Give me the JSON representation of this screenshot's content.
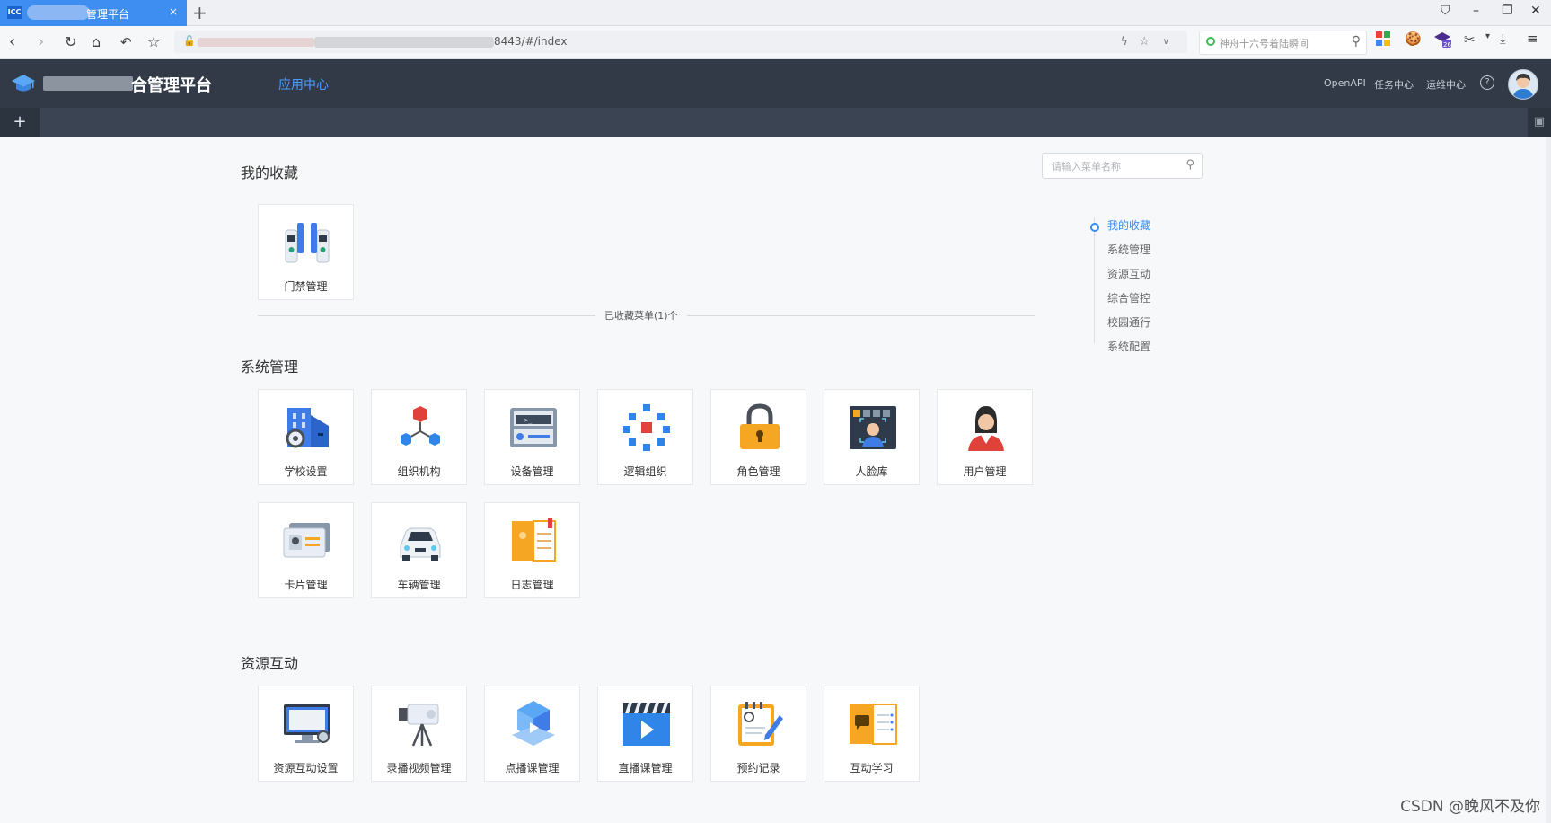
{
  "browser": {
    "tab": {
      "favicon": "ICC",
      "title": "管理平台",
      "close": "×"
    },
    "new_tab": "+",
    "window_controls": {
      "shirt": "⛉",
      "minimize": "–",
      "restore": "❐",
      "close": "✕"
    },
    "url_text": "8443/#/index",
    "search_placeholder": "神舟十六号着陆瞬间",
    "icons": [
      "back-icon",
      "forward-icon",
      "reload-icon",
      "home-icon",
      "undo-icon",
      "star-icon"
    ]
  },
  "app": {
    "brand": "合管理平台",
    "nav_active": "应用中心",
    "header_links": [
      "OpenAPI",
      "任务中心",
      "运维中心"
    ],
    "help": "?",
    "add_tab": "+",
    "trash": "🗑"
  },
  "menu_search": {
    "placeholder": "请输入菜单名称"
  },
  "favorites": {
    "title": "我的收藏",
    "items": [
      {
        "label": "门禁管理",
        "icon": "access-control-icon"
      }
    ],
    "divider_label": "已收藏菜单(1)个"
  },
  "system": {
    "title": "系统管理",
    "items": [
      {
        "label": "学校设置",
        "icon": "school-settings-icon"
      },
      {
        "label": "组织机构",
        "icon": "organization-icon"
      },
      {
        "label": "设备管理",
        "icon": "device-management-icon"
      },
      {
        "label": "逻辑组织",
        "icon": "logic-organization-icon"
      },
      {
        "label": "角色管理",
        "icon": "role-management-icon"
      },
      {
        "label": "人脸库",
        "icon": "face-library-icon"
      },
      {
        "label": "用户管理",
        "icon": "user-management-icon"
      },
      {
        "label": "卡片管理",
        "icon": "card-management-icon"
      },
      {
        "label": "车辆管理",
        "icon": "vehicle-management-icon"
      },
      {
        "label": "日志管理",
        "icon": "log-management-icon"
      }
    ]
  },
  "resource": {
    "title": "资源互动",
    "items": [
      {
        "label": "资源互动设置",
        "icon": "resource-settings-icon"
      },
      {
        "label": "录播视频管理",
        "icon": "recording-video-icon"
      },
      {
        "label": "点播课管理",
        "icon": "vod-course-icon"
      },
      {
        "label": "直播课管理",
        "icon": "live-course-icon"
      },
      {
        "label": "预约记录",
        "icon": "reservation-record-icon"
      },
      {
        "label": "互动学习",
        "icon": "interactive-learning-icon"
      }
    ]
  },
  "anchor_nav": [
    "我的收藏",
    "系统管理",
    "资源互动",
    "综合管控",
    "校园通行",
    "系统配置"
  ],
  "watermark": "CSDN @晚风不及你"
}
